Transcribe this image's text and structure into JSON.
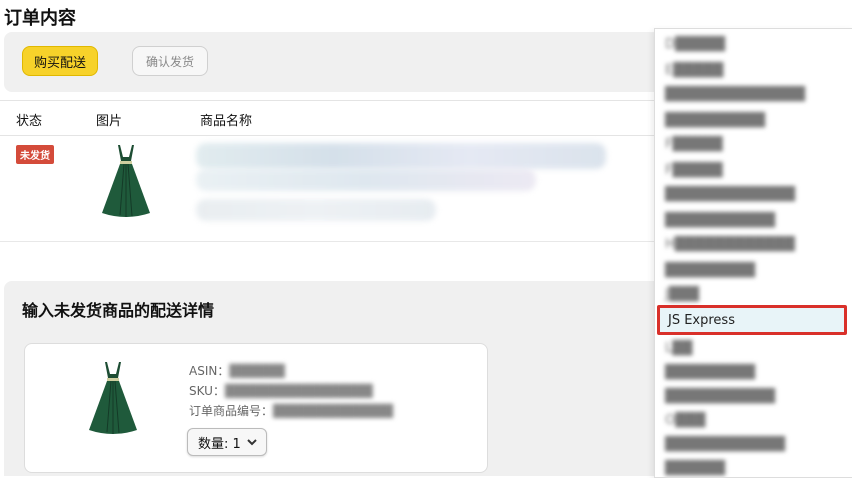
{
  "page": {
    "title": "订单内容"
  },
  "actions": {
    "buy_shipping": "购买配送",
    "confirm_shipment": "确认发货"
  },
  "table": {
    "headers": [
      "状态",
      "图片",
      "商品名称"
    ],
    "row": {
      "status": "未发货"
    }
  },
  "details": {
    "title": "输入未发货商品的配送详情",
    "asin_label": "ASIN：",
    "sku_label": "SKU：",
    "order_item_label": "订单商品编号：",
    "quantity_label": "数量: 1"
  },
  "carrier_dropdown": {
    "selected": "JS Express"
  },
  "colors": {
    "accent": "#f7d22a",
    "status_badge": "#d44b3a",
    "highlight_border": "#d9302a"
  }
}
